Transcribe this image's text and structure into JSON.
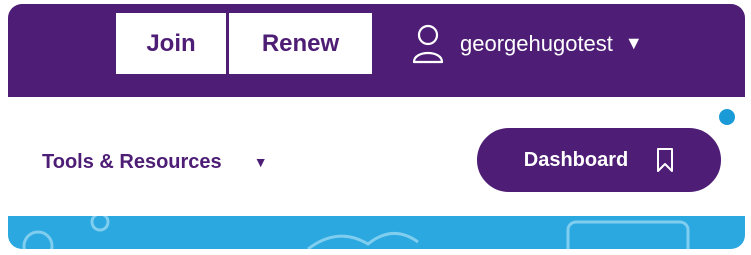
{
  "header": {
    "join_label": "Join",
    "renew_label": "Renew",
    "username": "georgehugotest",
    "user_icon": "user-icon",
    "dropdown_icon": "caret-down-icon"
  },
  "nav": {
    "tools_label": "Tools & Resources",
    "tools_icon": "caret-down-icon",
    "dashboard_label": "Dashboard",
    "dashboard_icon": "bookmark-icon"
  },
  "colors": {
    "brand_purple": "#4e1d75",
    "accent_blue": "#2aa8df",
    "dot_blue": "#1a9ad6"
  }
}
